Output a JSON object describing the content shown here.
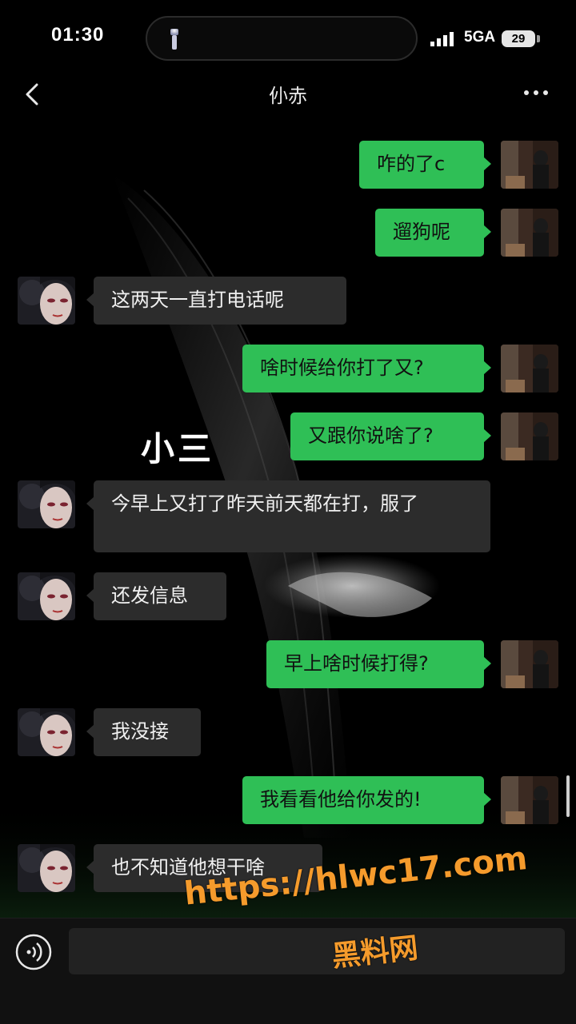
{
  "status_bar": {
    "time": "01:30",
    "network": "5GA",
    "battery": "29"
  },
  "header": {
    "title": "仦赤"
  },
  "overlay_label": "小三",
  "messages": [
    {
      "dir": "out",
      "text": "咋的了c"
    },
    {
      "dir": "out",
      "text": "遛狗呢"
    },
    {
      "dir": "in",
      "text": "这两天一直打电话呢"
    },
    {
      "dir": "out",
      "text": "啥时候给你打了又?"
    },
    {
      "dir": "out",
      "text": "又跟你说啥了?"
    },
    {
      "dir": "in",
      "text": "今早上又打了昨天前天都在打，服了"
    },
    {
      "dir": "in",
      "text": "还发信息"
    },
    {
      "dir": "out",
      "text": "早上啥时候打得?"
    },
    {
      "dir": "in",
      "text": "我没接"
    },
    {
      "dir": "out",
      "text": "我看看他给你发的!"
    },
    {
      "dir": "in",
      "text": "也不知道他想干啥"
    }
  ],
  "watermark": {
    "url": "https://hlwc17.com",
    "name": "黑料网"
  },
  "colors": {
    "outgoing_bubble": "#2fbf56",
    "incoming_bubble": "#2c2c2c",
    "watermark": "#f59b2c"
  },
  "icons": {
    "back": "chevron-left-icon",
    "more": "more-dots-icon",
    "voice": "voice-input-icon",
    "flashlight": "flashlight-icon"
  }
}
